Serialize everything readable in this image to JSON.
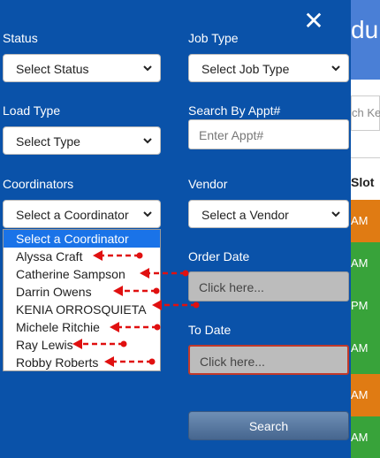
{
  "background": {
    "header_title": "du",
    "search_placeholder": "ch Ke",
    "column_header": "Slot",
    "row_labels": [
      "AM",
      "AM",
      "PM",
      "AM",
      "PM",
      "AM",
      "AM"
    ],
    "row_colors": [
      "#e07b13",
      "#38a33a",
      "#38a33a",
      "#38a33a",
      "#38a33a",
      "#e07b13",
      "#38a33a"
    ],
    "header_color": "#4a7fd6"
  },
  "panel": {
    "close_glyph": "✕",
    "status": {
      "label": "Status",
      "value": "Select Status"
    },
    "job_type": {
      "label": "Job Type",
      "value": "Select Job Type"
    },
    "load_type": {
      "label": "Load Type",
      "value": "Select Type"
    },
    "search_appt": {
      "label": "Search By Appt#",
      "placeholder": "Enter Appt#"
    },
    "coordinators": {
      "label": "Coordinators",
      "value": "Select a Coordinator",
      "options": [
        "Select a Coordinator",
        "Alyssa Craft",
        "Catherine Sampson",
        "Darrin Owens",
        "KENIA ORROSQUIETA",
        "Michele Ritchie",
        "Ray Lewis",
        "Robby Roberts"
      ],
      "selected_index": 0
    },
    "vendor": {
      "label": "Vendor",
      "value": "Select a Vendor"
    },
    "order_date": {
      "label": "Order Date",
      "placeholder": "Click here..."
    },
    "to_date": {
      "label": "To Date",
      "placeholder": "Click here..."
    },
    "search_button": "Search"
  },
  "colors": {
    "panel_bg": "#0a52a9",
    "annotation_arrow": "#e01010",
    "dropdown_highlight": "#1a73e8"
  }
}
